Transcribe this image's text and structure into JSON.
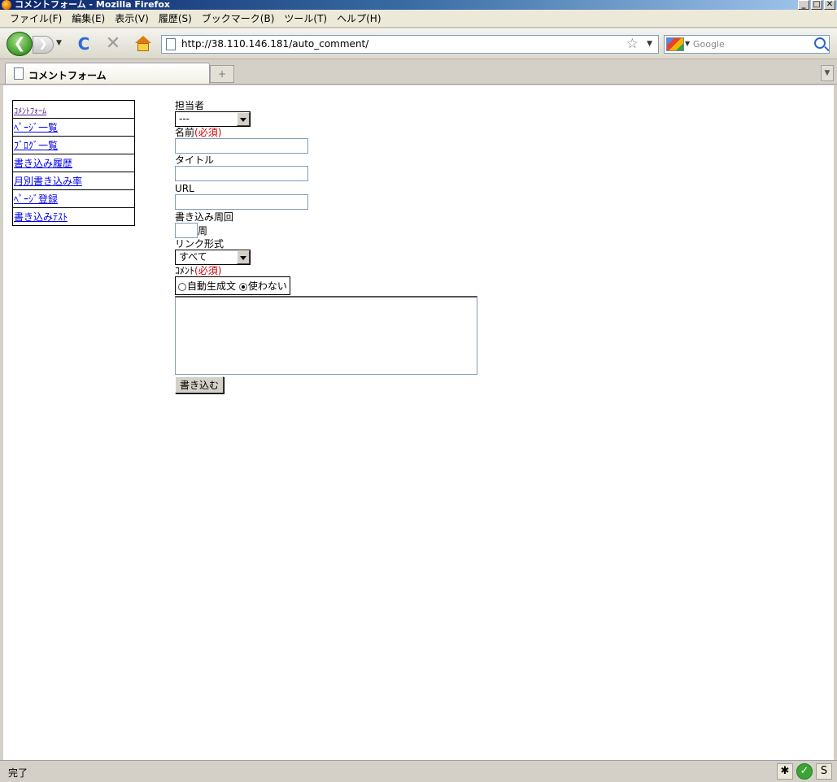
{
  "window": {
    "title": "コメントフォーム - Mozilla Firefox",
    "buttons": [
      "_",
      "□",
      "✕"
    ]
  },
  "menu": [
    "ファイル(F)",
    "編集(E)",
    "表示(V)",
    "履歴(S)",
    "ブックマーク(B)",
    "ツール(T)",
    "ヘルプ(H)"
  ],
  "nav": {
    "back_glyph": "❮",
    "forward_glyph": "❯",
    "reload_glyph": "C",
    "stop_glyph": "✕",
    "url": "http://38.110.146.181/auto_comment/",
    "star_glyph": "☆",
    "search_placeholder": "Google"
  },
  "tabs": [
    {
      "label": "コメントフォーム"
    }
  ],
  "new_tab_glyph": "+",
  "sidebar": {
    "items": [
      {
        "label": "ｺﾒﾝﾄﾌｫｰﾑ"
      },
      {
        "label": "ﾍﾟｰｼﾞ一覧"
      },
      {
        "label": "ﾌﾞﾛｸﾞ一覧"
      },
      {
        "label": "書き込み履歴"
      },
      {
        "label": "月別書き込み率"
      },
      {
        "label": "ﾍﾟｰｼﾞ登録"
      },
      {
        "label": "書き込みﾃｽﾄ"
      }
    ]
  },
  "form": {
    "assignee_label": "担当者",
    "assignee_value": "---",
    "name_label": "名前",
    "required_mark": "(必須)",
    "title_label": "タイトル",
    "url_label": "URL",
    "cycle_label": "書き込み周回",
    "cycle_unit": "周",
    "link_label": "リンク形式",
    "link_value": "すべて",
    "comment_label": "ｺﾒﾝﾄ",
    "radio_auto": "自動生成文",
    "radio_none": "使わない",
    "submit_label": "書き込む"
  },
  "status": {
    "text": "完了"
  }
}
